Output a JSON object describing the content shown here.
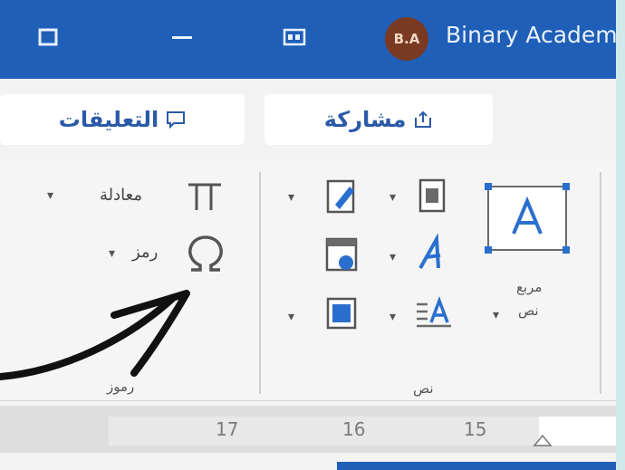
{
  "titlebar": {
    "avatar_initials": "B.A",
    "account_name": "Binary Academy",
    "restore_icon": "restore-icon",
    "minimize_icon": "minimize-icon",
    "display_icon": "display-options-icon"
  },
  "ribbon_top": {
    "comments_label": "التعليقات",
    "share_label": "مشاركة"
  },
  "symbols_group": {
    "equation_label": "معادلة",
    "symbol_label": "رمز",
    "group_label": "رموز"
  },
  "text_group": {
    "textbox_label_line1": "مربع",
    "textbox_label_line2": "نص",
    "group_label": "نص"
  },
  "ruler": {
    "marks": [
      "17",
      "16",
      "15"
    ]
  },
  "colors": {
    "titlebar": "#1f5fb8",
    "pill_text": "#2b5aa8",
    "avatar": "#7a3a22",
    "edge": "#cfe9ec"
  }
}
